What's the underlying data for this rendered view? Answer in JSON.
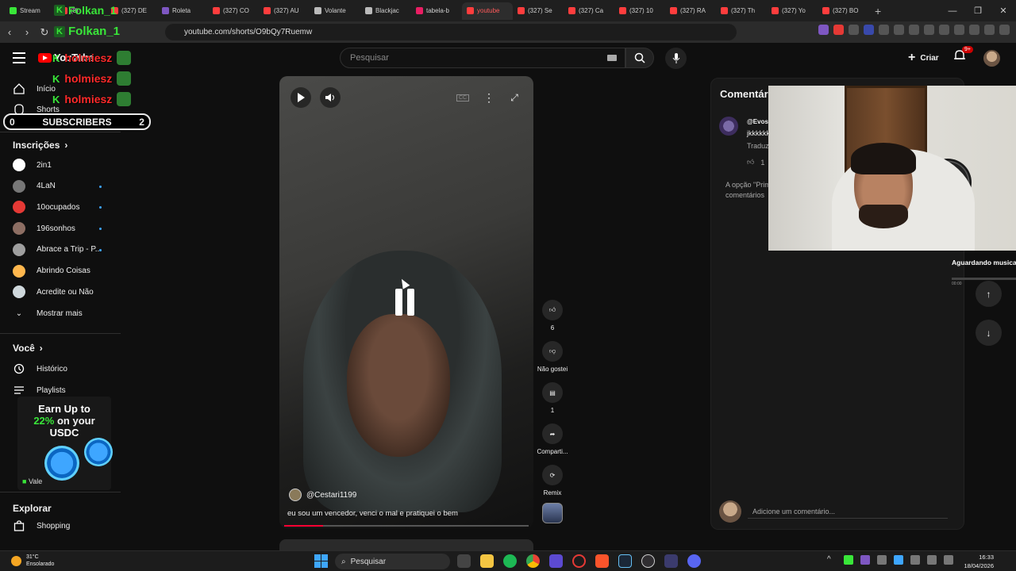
{
  "browser": {
    "tabs": [
      {
        "label": "Stream",
        "color": "#39e639"
      },
      {
        "label": "(8)",
        "color": "#ff3d3d"
      },
      {
        "label": "(327) DE",
        "color": "#ff3d3d"
      },
      {
        "label": "Roleta",
        "color": "#7e57c2"
      },
      {
        "label": "(327) CO",
        "color": "#ff3d3d"
      },
      {
        "label": "(327) AU",
        "color": "#ff3d3d"
      },
      {
        "label": "Volante",
        "color": "#bbbbbb"
      },
      {
        "label": "Blackjac",
        "color": "#bbbbbb"
      },
      {
        "label": "tabela-b",
        "color": "#e91e63"
      },
      {
        "label": "youtube",
        "color": "#ff3d3d"
      },
      {
        "label": "(327) Se",
        "color": "#ff3d3d"
      },
      {
        "label": "(327) Ca",
        "color": "#ff3d3d"
      },
      {
        "label": "(327) 10",
        "color": "#ff3d3d"
      },
      {
        "label": "(327) RA",
        "color": "#ff3d3d"
      },
      {
        "label": "(327) Th",
        "color": "#ff3d3d"
      },
      {
        "label": "(327) Yo",
        "color": "#ff3d3d"
      },
      {
        "label": "(327) BO",
        "color": "#ff3d3d"
      }
    ],
    "active_tab": "youtube",
    "url": "youtube.com/shorts/O9bQy7Ruemw",
    "overlay_username": "Folkan_1"
  },
  "overlay": {
    "chat_names": [
      "holmiesz",
      "holmiesz",
      "holmiesz"
    ],
    "subscribers_label": "SUBSCRIBERS",
    "subscribers_left": "0",
    "subscribers_right": "2"
  },
  "header": {
    "logo_text": "YouTube",
    "search_placeholder": "Pesquisar",
    "create_label": "Criar",
    "notif_badge": "9+"
  },
  "sidebar": {
    "inicio": "Início",
    "shorts": "Shorts",
    "inscricoes": "Inscrições",
    "channels": [
      {
        "name": "2in1",
        "color": "#ffffff",
        "dot": false
      },
      {
        "name": "4LaN",
        "color": "#777777",
        "dot": true
      },
      {
        "name": "10ocupados",
        "color": "#e53935",
        "dot": true
      },
      {
        "name": "196sonhos",
        "color": "#8d6e63",
        "dot": true
      },
      {
        "name": "Abrace a Trip - P...",
        "color": "#9e9e9e",
        "dot": true
      },
      {
        "name": "Abrindo Coisas",
        "color": "#ffb74d",
        "dot": false
      },
      {
        "name": "Acredite ou Não",
        "color": "#cfd8dc",
        "dot": false
      }
    ],
    "mostrar_mais": "Mostrar mais",
    "voce": "Você",
    "historico": "Histórico",
    "playlists": "Playlists",
    "explorar": "Explorar",
    "shopping": "Shopping"
  },
  "ad": {
    "line1": "Earn Up to",
    "line2_highlight": "22%",
    "line2_rest": "on your",
    "line3": "USDC",
    "vale": "Vale"
  },
  "video": {
    "author": "@Cestari1199",
    "caption": "eu sou um vencedor, venci o mal e pratiquei o bem",
    "progress": 0.16
  },
  "actions": {
    "likes": "6",
    "dislike_label": "Não gostei",
    "comments": "1",
    "share_label": "Comparti...",
    "remix_label": "Remix"
  },
  "comments": {
    "title": "Comentári",
    "user": "@Evost",
    "text": "jkkkkkk",
    "translate": "Traduz",
    "like_count": "1",
    "note": "A opção \"Prim comentários",
    "add_placeholder": "Adicione um comentário..."
  },
  "right_panel": {
    "music_text": "Aguardando musica",
    "small": "00:00"
  },
  "taskbar": {
    "temp": "31°C",
    "weather": "Ensolarado",
    "search": "Pesquisar",
    "time": "16:33",
    "date": "18/04/2026"
  }
}
